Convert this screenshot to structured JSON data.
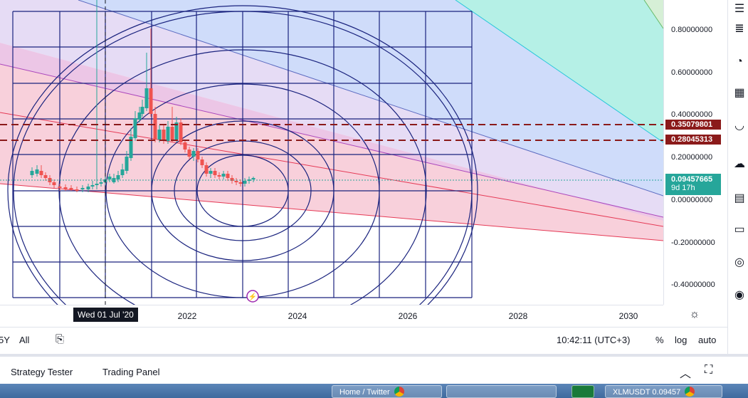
{
  "price_scale": {
    "ticks": [
      "0.80000000",
      "0.60000000",
      "0.40000000",
      "0.20000000",
      "0.00000000",
      "-0.20000000",
      "-0.40000000"
    ],
    "tick_values": [
      0.8,
      0.6,
      0.4,
      0.2,
      0.0,
      -0.2,
      -0.4
    ],
    "tags": [
      {
        "label": "0.35079801",
        "color": "#8b1a1a"
      },
      {
        "label": "0.28045313",
        "color": "#8b1a1a"
      },
      {
        "label": "0.09457665",
        "sublabel": "9d 17h",
        "color": "#26a69a"
      }
    ]
  },
  "time_scale": {
    "ticks": [
      "2022",
      "2024",
      "2026",
      "2028",
      "2030"
    ],
    "crosshair_date": "Wed 01 Jul '20"
  },
  "bottom_controls": {
    "range_5y": "5Y",
    "range_all": "All",
    "time": "10:42:11 (UTC+3)",
    "percent": "%",
    "log": "log",
    "auto": "auto"
  },
  "panels": {
    "strategy_tester": "Strategy Tester",
    "trading_panel": "Trading Panel"
  },
  "taskbar": {
    "task1": "Home / Twitter",
    "task2": "XLMUSDT 0.09457"
  },
  "chart_data": {
    "type": "candlestick",
    "y_range": [
      -0.47,
      0.93
    ],
    "horizontal_levels": [
      0.35079801,
      0.28045313
    ],
    "last_price": 0.09457665,
    "colors": {
      "up": "#26a69a",
      "down": "#ef5350",
      "level": "#8b1a1a",
      "grid": "#1a237e"
    }
  }
}
